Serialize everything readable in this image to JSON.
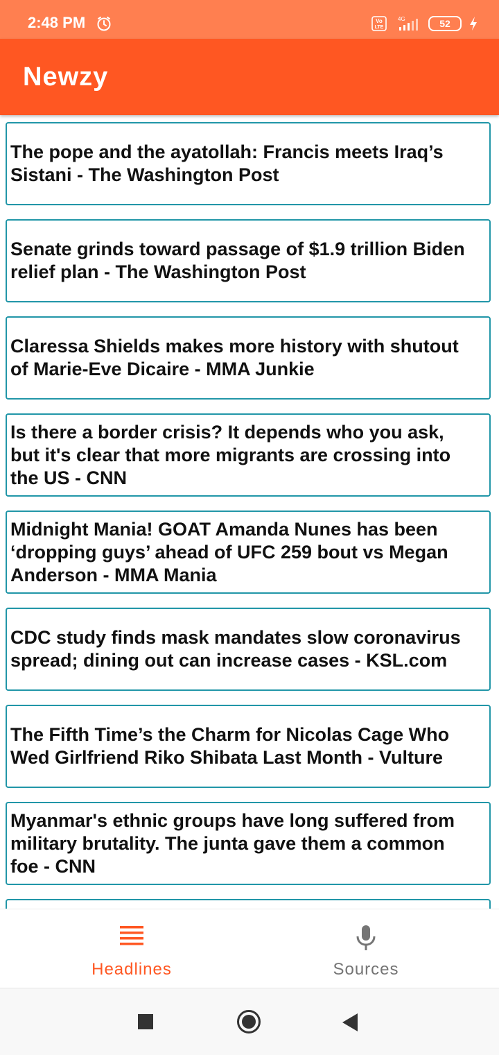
{
  "status_bar": {
    "time": "2:48 PM",
    "battery": "52",
    "network": "4G",
    "volte": "Vo LTE"
  },
  "app_bar": {
    "title": "Newzy"
  },
  "headlines": [
    "The pope and the ayatollah: Francis meets Iraq’s Sistani - The Washington Post",
    "Senate grinds toward passage of $1.9 trillion Biden relief plan - The Washington Post",
    "Claressa Shields makes more history with shutout of Marie-Eve Dicaire - MMA Junkie",
    "Is there a border crisis? It depends who you ask, but it's clear that more migrants are crossing into the US - CNN",
    "Midnight Mania! GOAT Amanda Nunes has been ‘dropping guys’ ahead of UFC 259 bout vs Megan Anderson - MMA Mania",
    "CDC study finds mask mandates slow coronavirus spread; dining out can increase cases - KSL.com",
    "The Fifth Time’s the Charm for Nicolas Cage Who Wed Girlfriend Riko Shibata Last Month - Vulture",
    "Myanmar's ethnic groups have long suffered from military brutality. The junta gave them a common foe - CNN"
  ],
  "bottom_nav": {
    "headlines_label": "Headlines",
    "sources_label": "Sources",
    "active_color": "#ff5722",
    "inactive_color": "#757575"
  },
  "colors": {
    "status_bar": "#ff7f50",
    "app_bar": "#ff5722",
    "card_border": "#2196a8"
  }
}
